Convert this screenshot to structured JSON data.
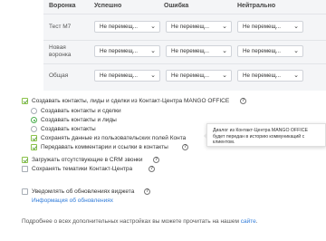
{
  "table": {
    "headers": {
      "funnel": "Воронка",
      "success": "Успешно",
      "error": "Ошибка",
      "neutral": "Нейтрально"
    },
    "rows": [
      {
        "label": "Тест М7",
        "success": "Не перемещ...",
        "error": "Не перемещ...",
        "neutral": "Не перемещ..."
      },
      {
        "label": "Новая воронка",
        "label_line1": "Новая",
        "label_line2": "воронка",
        "success": "Не перемещ...",
        "error": "Не перемещ...",
        "neutral": "Не перемещ..."
      },
      {
        "label": "Общая",
        "success": "Не перемещ...",
        "error": "Не перемещ...",
        "neutral": "Не перемещ..."
      }
    ]
  },
  "options": {
    "create_main": "Создавать контакты, лиды и сделки из Контакт-Центра MANGO OFFICE",
    "radio_contacts_deals": "Создавать контакты и сделки",
    "radio_contacts_leads": "Создавать контакты и лиды",
    "radio_contacts": "Создавать контакты",
    "save_custom_fields": "Сохранять данные из пользовательских полей Конта",
    "pass_comments": "Передавать комментарии и ссылки в контакты",
    "load_missing_calls": "Загружать отсутствующие в CRM звонки",
    "save_topics": "Сохранять тематики Контакт-Центра",
    "notify_updates": "Уведомлять об обновлениях виджета",
    "widget_update_info": "Информация об обновлениях"
  },
  "tooltip": {
    "line1": "Диалог из Контакт-Центра MANGO OFFICE",
    "line2": "будет передан в историю коммуникаций с",
    "line3": "клиентом."
  },
  "footer": {
    "text": "Подробнее о всех дополнительных настройках вы можете прочитать на нашем",
    "link": "сайте",
    "period": "."
  },
  "colors": {
    "accent_link": "#2f7bd9",
    "check_green": "#6aa84f",
    "panel_bg": "#f4f5f7"
  },
  "icons": {
    "help": "question-circle-icon",
    "dropdown": "chevron-down-icon",
    "check": "check-icon"
  }
}
